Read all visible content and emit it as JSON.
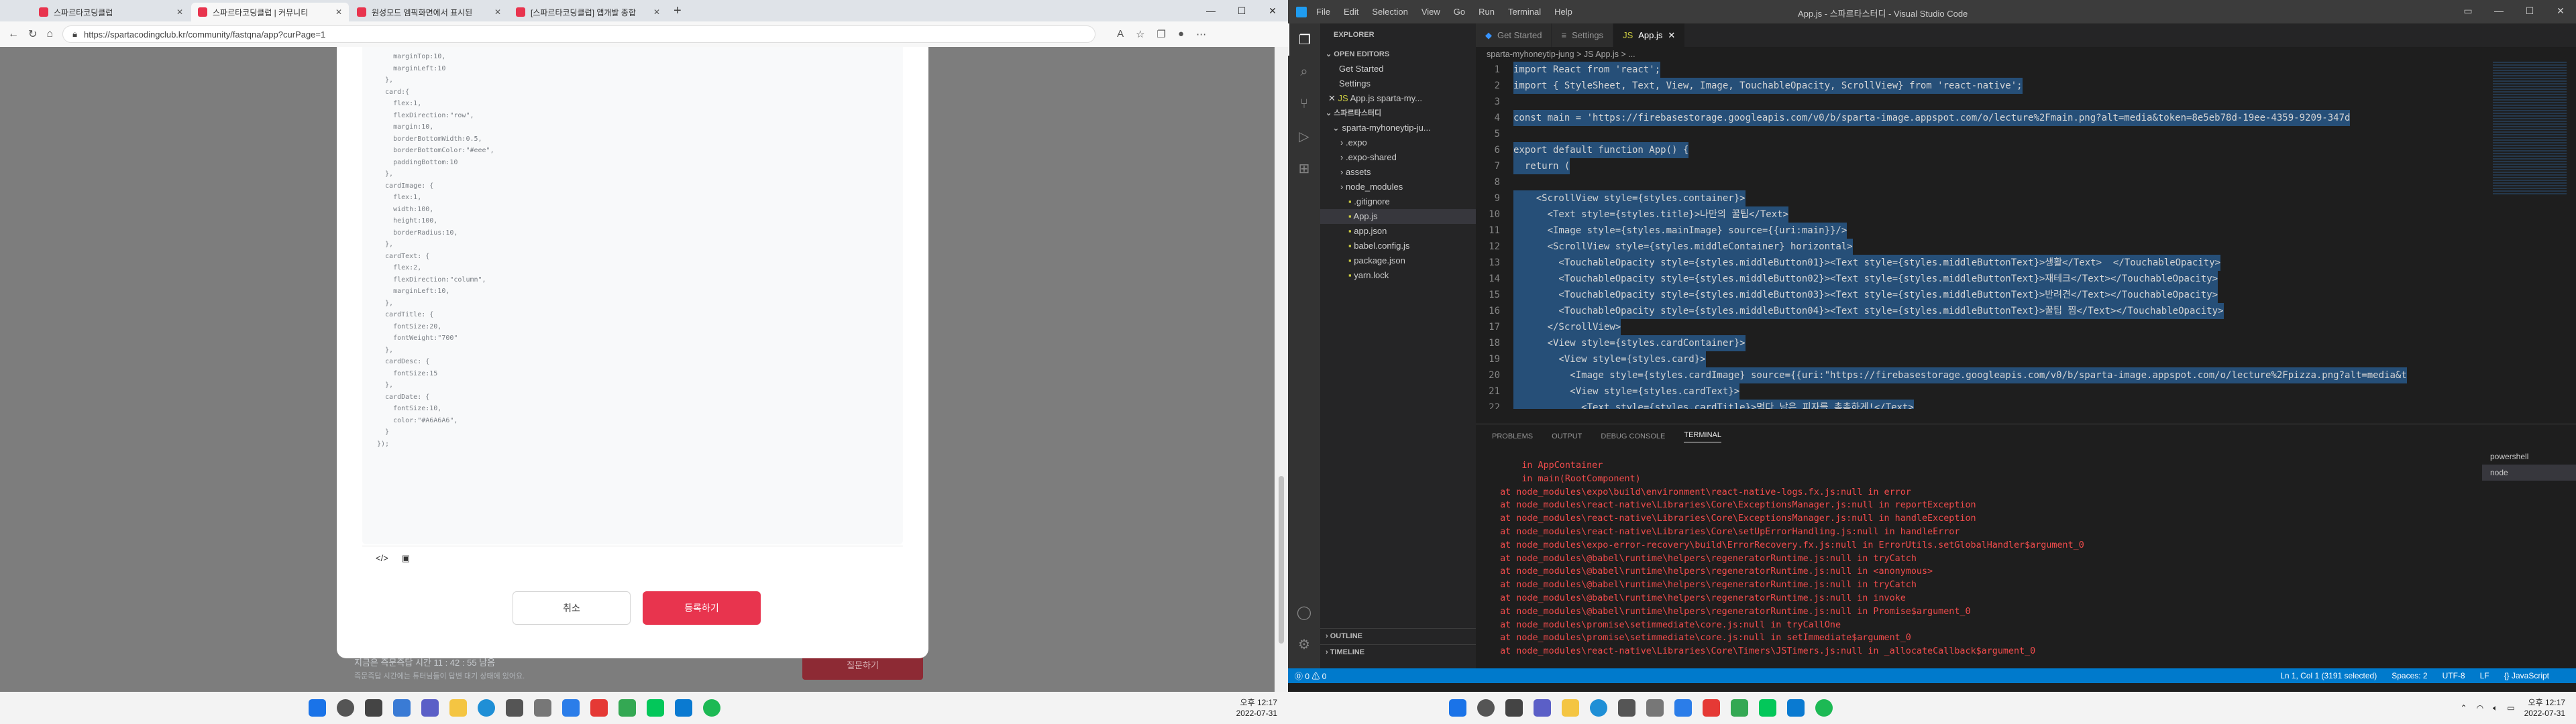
{
  "browser": {
    "tabs": [
      {
        "label": "스파르타코딩클럽"
      },
      {
        "label": "스파르타코딩클럽 | 커뮤니티"
      },
      {
        "label": "원성모드 엠픽화면에서 표시된"
      },
      {
        "label": "[스파르타코딩클럽] 앱개발 종합"
      }
    ],
    "url": "https://spartacodingclub.kr/community/fastqna/app?curPage=1",
    "code_lines": [
      "    marginTop:10,",
      "    marginLeft:10",
      "  },",
      "  card:{",
      "    flex:1,",
      "    flexDirection:\"row\",",
      "    margin:10,",
      "    borderBottomWidth:0.5,",
      "    borderBottomColor:\"#eee\",",
      "    paddingBottom:10",
      "",
      "  },",
      "  cardImage: {",
      "    flex:1,",
      "    width:100,",
      "    height:100,",
      "    borderRadius:10,",
      "  },",
      "  cardText: {",
      "    flex:2,",
      "    flexDirection:\"column\",",
      "    marginLeft:10,",
      "  },",
      "  cardTitle: {",
      "    fontSize:20,",
      "    fontWeight:\"700\"",
      "  },",
      "  cardDesc: {",
      "    fontSize:15",
      "  },",
      "  cardDate: {",
      "    fontSize:10,",
      "    color:\"#A6A6A6\",",
      "  }",
      "});"
    ],
    "cancel_label": "취소",
    "submit_label": "등록하기",
    "bottom_text": "지금은 즉문즉답 시간 11 : 42 : 55 남음",
    "bottom_subtext": "즉문즉답 시간에는 튜터님들이 답변 대기 상태에 있어요.",
    "bottom_button": "질문하기"
  },
  "vscode": {
    "window_title": "App.js - 스파르타스터디 - Visual Studio Code",
    "menus": [
      "File",
      "Edit",
      "Selection",
      "View",
      "Go",
      "Run",
      "Terminal",
      "Help"
    ],
    "explorer": {
      "title": "EXPLORER",
      "open_editors": "OPEN EDITORS",
      "open_items": [
        "Get Started",
        "Settings",
        "App.js  sparta-my..."
      ],
      "workspace": "스파르타스터디",
      "project": "sparta-myhoneytip-ju...",
      "files": [
        ".expo",
        ".expo-shared",
        "assets",
        "node_modules",
        ".gitignore",
        "App.js",
        "app.json",
        "babel.config.js",
        "package.json",
        "yarn.lock"
      ],
      "outline": "OUTLINE",
      "timeline": "TIMELINE"
    },
    "tabs": [
      "Get Started",
      "Settings",
      "App.js"
    ],
    "breadcrumb": "sparta-myhoneytip-jung  >  JS App.js  > ...",
    "code": [
      "import React from 'react';",
      "import { StyleSheet, Text, View, Image, TouchableOpacity, ScrollView} from 'react-native';",
      "",
      "const main = 'https://firebasestorage.googleapis.com/v0/b/sparta-image.appspot.com/o/lecture%2Fmain.png?alt=media&token=8e5eb78d-19ee-4359-9209-347d",
      "",
      "export default function App() {",
      "  return (",
      "",
      "    <ScrollView style={styles.container}>",
      "      <Text style={styles.title}>나만의 꿀팁</Text>",
      "      <Image style={styles.mainImage} source={{uri:main}}/>",
      "      <ScrollView style={styles.middleContainer} horizontal>",
      "        <TouchableOpacity style={styles.middleButton01}><Text style={styles.middleButtonText}>생활</Text>  </TouchableOpacity>",
      "        <TouchableOpacity style={styles.middleButton02}><Text style={styles.middleButtonText}>재테크</Text></TouchableOpacity>",
      "        <TouchableOpacity style={styles.middleButton03}><Text style={styles.middleButtonText}>반려견</Text></TouchableOpacity>",
      "        <TouchableOpacity style={styles.middleButton04}><Text style={styles.middleButtonText}>꿀팁 찜</Text></TouchableOpacity>",
      "      </ScrollView>",
      "      <View style={styles.cardContainer}>",
      "        <View style={styles.card}>",
      "          <Image style={styles.cardImage} source={{uri:\"https://firebasestorage.googleapis.com/v0/b/sparta-image.appspot.com/o/lecture%2Fpizza.png?alt=media&t",
      "          <View style={styles.cardText}>",
      "            <Text style={styles.cardTitle}>먹다 남은 피자를 촉촉하게!</Text>"
    ],
    "panel_tabs": [
      "PROBLEMS",
      "OUTPUT",
      "DEBUG CONSOLE",
      "TERMINAL"
    ],
    "terminal": [
      "      in AppContainer",
      "      in main(RootComponent)",
      "  at node_modules\\expo\\build\\environment\\react-native-logs.fx.js:null in error",
      "  at node_modules\\react-native\\Libraries\\Core\\ExceptionsManager.js:null in reportException",
      "  at node_modules\\react-native\\Libraries\\Core\\ExceptionsManager.js:null in handleException",
      "  at node_modules\\react-native\\Libraries\\Core\\setUpErrorHandling.js:null in handleError",
      "  at node_modules\\expo-error-recovery\\build\\ErrorRecovery.fx.js:null in ErrorUtils.setGlobalHandler$argument_0",
      "  at node_modules\\@babel\\runtime\\helpers\\regeneratorRuntime.js:null in tryCatch",
      "  at node_modules\\@babel\\runtime\\helpers\\regeneratorRuntime.js:null in <anonymous>",
      "  at node_modules\\@babel\\runtime\\helpers\\regeneratorRuntime.js:null in tryCatch",
      "  at node_modules\\@babel\\runtime\\helpers\\regeneratorRuntime.js:null in invoke",
      "  at node_modules\\@babel\\runtime\\helpers\\regeneratorRuntime.js:null in Promise$argument_0",
      "  at node_modules\\promise\\setimmediate\\core.js:null in tryCallOne",
      "  at node_modules\\promise\\setimmediate\\core.js:null in setImmediate$argument_0",
      "  at node_modules\\react-native\\Libraries\\Core\\Timers\\JSTimers.js:null in _allocateCallback$argument_0"
    ],
    "shells": [
      "powershell",
      "node"
    ],
    "status": {
      "errors": "⓪ 0  ⚠ 0",
      "position": "Ln 1, Col 1 (3191 selected)",
      "spaces": "Spaces: 2",
      "encoding": "UTF-8",
      "eol": "LF",
      "language": "{} JavaScript"
    }
  },
  "taskbar": {
    "time": "오후 12:17",
    "date": "2022-07-31"
  }
}
